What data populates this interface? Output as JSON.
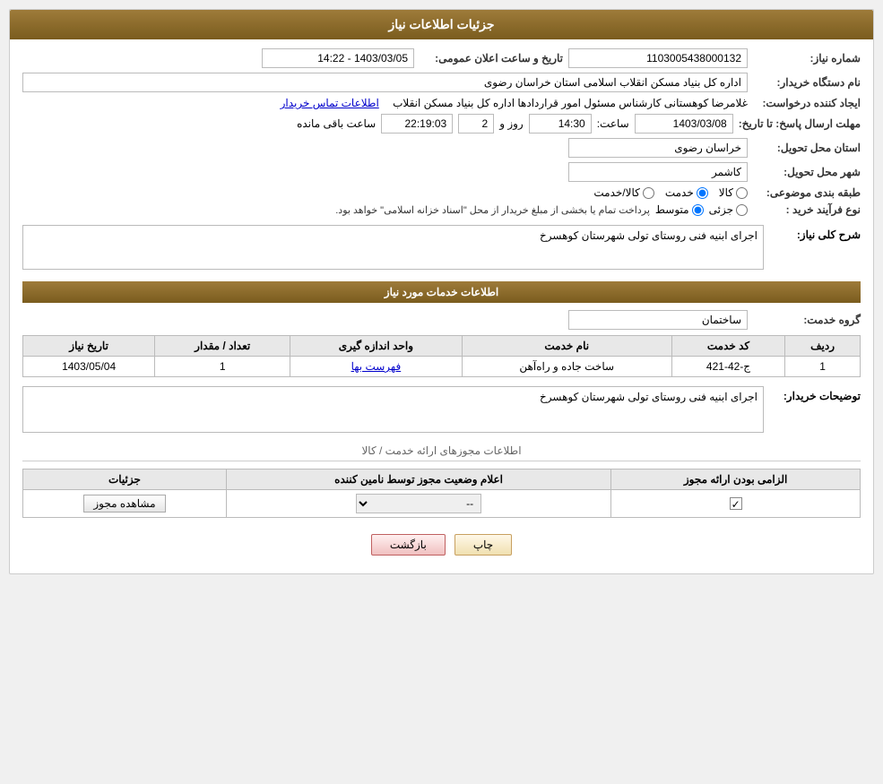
{
  "header": {
    "title": "جزئیات اطلاعات نیاز"
  },
  "fields": {
    "need_number_label": "شماره نیاز:",
    "need_number_value": "1103005438000132",
    "announcement_label": "تاریخ و ساعت اعلان عمومی:",
    "announcement_value": "1403/03/05 - 14:22",
    "buyer_name_label": "نام دستگاه خریدار:",
    "buyer_name_value": "اداره کل بنیاد مسکن انقلاب اسلامی استان خراسان رضوی",
    "creator_label": "ایجاد کننده درخواست:",
    "creator_value": "غلامرضا کوهستانی کارشناس مسئول امور قراردادها اداره کل بنیاد مسکن انقلاب",
    "contact_link": "اطلاعات تماس خریدار",
    "deadline_label": "مهلت ارسال پاسخ: تا تاریخ:",
    "deadline_date": "1403/03/08",
    "deadline_time_label": "ساعت:",
    "deadline_time": "14:30",
    "deadline_day_label": "روز و",
    "deadline_days": "2",
    "deadline_remaining_label": "ساعت باقی مانده",
    "deadline_remaining": "22:19:03",
    "province_label": "استان محل تحویل:",
    "province_value": "خراسان رضوی",
    "city_label": "شهر محل تحویل:",
    "city_value": "کاشمر",
    "category_label": "طبقه بندی موضوعی:",
    "category_options": [
      "کالا",
      "خدمت",
      "کالا/خدمت"
    ],
    "category_selected": "خدمت",
    "process_label": "نوع فرآیند خرید :",
    "process_options": [
      "جزئی",
      "متوسط"
    ],
    "process_selected": "متوسط",
    "process_note": "پرداخت تمام یا بخشی از مبلغ خریدار از محل \"اسناد خزانه اسلامی\" خواهد بود.",
    "general_desc_label": "شرح کلی نیاز:",
    "general_desc_value": "اجرای ابنیه فنی روستای تولی شهرستان کوهسرخ"
  },
  "services_section": {
    "title": "اطلاعات خدمات مورد نیاز",
    "service_group_label": "گروه خدمت:",
    "service_group_value": "ساختمان",
    "table": {
      "columns": [
        "ردیف",
        "کد خدمت",
        "نام خدمت",
        "واحد اندازه گیری",
        "تعداد / مقدار",
        "تاریخ نیاز"
      ],
      "rows": [
        {
          "row_num": "1",
          "service_code": "ج-42-421",
          "service_name": "ساخت جاده و راه‌آهن",
          "unit": "فهرست بها",
          "quantity": "1",
          "date": "1403/05/04"
        }
      ]
    },
    "buyer_notes_label": "توضیحات خریدار:",
    "buyer_notes_value": "اجرای ابنیه فنی روستای تولی شهرستان کوهسرخ"
  },
  "license_section": {
    "title": "اطلاعات مجوزهای ارائه خدمت / کالا",
    "table": {
      "columns": [
        "الزامی بودن ارائه مجوز",
        "اعلام وضعیت مجوز توسط نامین کننده",
        "جزئیات"
      ],
      "rows": [
        {
          "required": true,
          "status_value": "--",
          "details_btn": "مشاهده مجوز"
        }
      ]
    }
  },
  "buttons": {
    "print_label": "چاپ",
    "back_label": "بازگشت"
  }
}
